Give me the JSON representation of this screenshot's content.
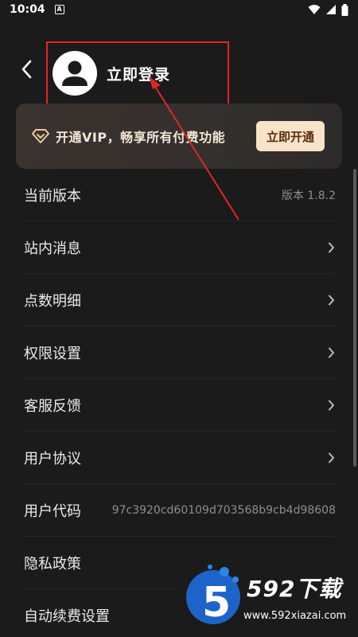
{
  "status_bar": {
    "time": "10:04",
    "notif_glyph": "A"
  },
  "header": {
    "back_icon": "chevron-left-icon",
    "avatar_icon": "person-icon",
    "login_label": "立即登录"
  },
  "vip": {
    "icon": "diamond-icon",
    "text": "开通VIP，畅享所有付费功能",
    "button_label": "立即开通"
  },
  "menu": {
    "items": [
      {
        "label": "当前版本",
        "value": "版本 1.8.2"
      },
      {
        "label": "站内消息"
      },
      {
        "label": "点数明细"
      },
      {
        "label": "权限设置"
      },
      {
        "label": "客服反馈"
      },
      {
        "label": "用户协议"
      },
      {
        "label": "用户代码",
        "value": "97c3920cd60109d703568b9cb4d98608"
      },
      {
        "label": "隐私政策"
      },
      {
        "label": "自动续费设置"
      }
    ]
  },
  "watermark": {
    "logo_text": "592下载",
    "url": "www.592xiazai.com",
    "logo_icon": "five-logo-icon"
  },
  "colors": {
    "highlight_red": "#e02626",
    "vip_button": "#f8e3c8",
    "background": "#1b1b1b"
  }
}
